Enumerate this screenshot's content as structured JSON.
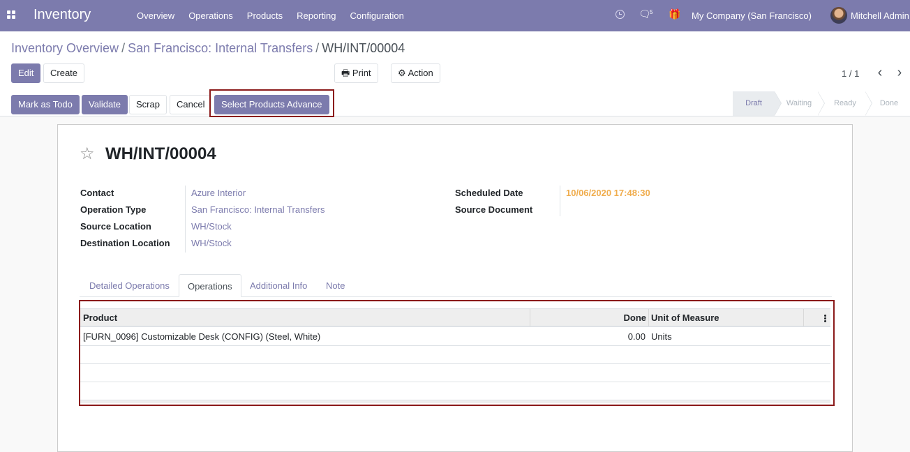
{
  "navbar": {
    "brand": "Inventory",
    "menu": [
      "Overview",
      "Operations",
      "Products",
      "Reporting",
      "Configuration"
    ],
    "chat_count": "5",
    "company": "My Company (San Francisco)",
    "user": "Mitchell Admin",
    "color": "#7c7bad"
  },
  "breadcrumb": {
    "items": [
      "Inventory Overview",
      "San Francisco: Internal Transfers"
    ],
    "separator": "/",
    "current": "WH/INT/00004"
  },
  "buttons": {
    "edit": "Edit",
    "create": "Create",
    "print": "Print",
    "action": "Action"
  },
  "pager": {
    "text": "1 / 1"
  },
  "statusbar": {
    "buttons": {
      "mark_todo": "Mark as Todo",
      "validate": "Validate",
      "scrap": "Scrap",
      "cancel": "Cancel",
      "select_products": "Select Products Advance"
    },
    "stages": [
      "Draft",
      "Waiting",
      "Ready",
      "Done"
    ],
    "active_stage": "Draft"
  },
  "form": {
    "title": "WH/INT/00004",
    "left_fields": [
      {
        "label": "Contact",
        "value": "Azure Interior"
      },
      {
        "label": "Operation Type",
        "value": "San Francisco: Internal Transfers"
      },
      {
        "label": "Source Location",
        "value": "WH/Stock"
      },
      {
        "label": "Destination Location",
        "value": "WH/Stock"
      }
    ],
    "right_fields": [
      {
        "label": "Scheduled Date",
        "value": "10/06/2020 17:48:30"
      },
      {
        "label": "Source Document",
        "value": ""
      }
    ]
  },
  "tabs": [
    "Detailed Operations",
    "Operations",
    "Additional Info",
    "Note"
  ],
  "active_tab": "Operations",
  "table": {
    "columns": [
      "Product",
      "Done",
      "Unit of Measure"
    ],
    "rows": [
      {
        "product": "[FURN_0096] Customizable Desk (CONFIG) (Steel, White)",
        "done": "0.00",
        "uom": "Units"
      }
    ]
  },
  "icons": {
    "apps": "apps-grid-icon",
    "clock": "clock-icon",
    "chat": "chat-icon",
    "gift": "gift-icon",
    "print": "print-icon",
    "action": "gear-icon",
    "star": "star-icon",
    "prev": "chevron-left-icon",
    "next": "chevron-right-icon",
    "kebab": "kebab-menu-icon"
  },
  "colors": {
    "highlight": "#8b1a1a",
    "warning_date": "#f0ad4e"
  }
}
